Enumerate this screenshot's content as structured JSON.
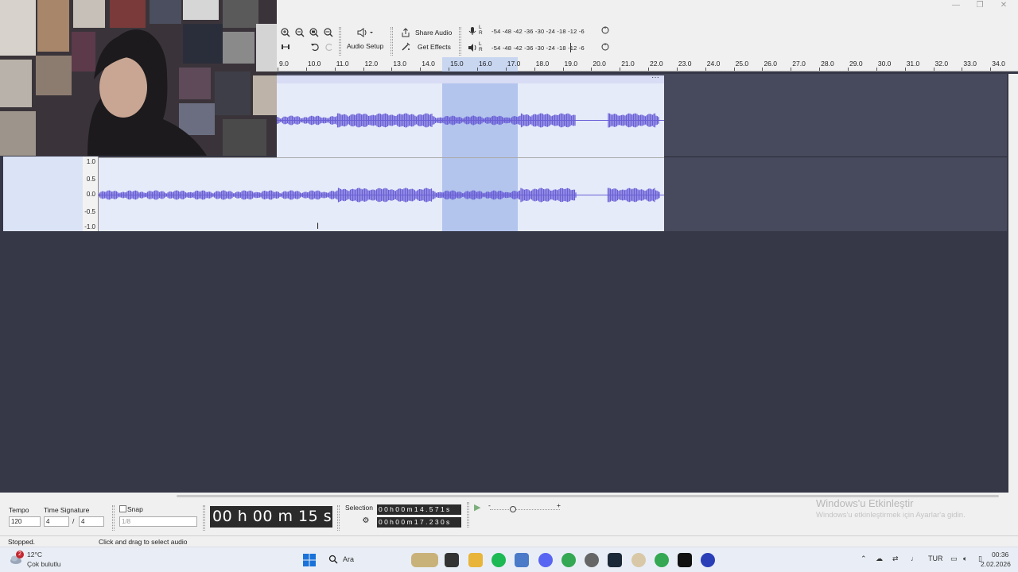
{
  "window": {
    "minimize": "—",
    "maximize": "❐",
    "close": "✕"
  },
  "toolbar": {
    "audio_setup_label": "Audio Setup",
    "share_audio_label": "Share Audio",
    "get_effects_label": "Get Effects",
    "record_meter_scale": "-54  -48  -42  -36  -30  -24  -18  -12  -6",
    "play_meter_scale": "-54  -48  -42  -36  -30  -24  -18  -12  -6",
    "lr": "L\nR"
  },
  "ruler": {
    "ticks": [
      "9.0",
      "10.0",
      "11.0",
      "12.0",
      "13.0",
      "14.0",
      "15.0",
      "16.0",
      "17.0",
      "18.0",
      "19.0",
      "20.0",
      "21.0",
      "22.0",
      "23.0",
      "24.0",
      "25.0",
      "26.0",
      "27.0",
      "28.0",
      "29.0",
      "30.0",
      "31.0",
      "32.0",
      "33.0",
      "34.0"
    ]
  },
  "track": {
    "menu": "···",
    "scale": [
      "1.0",
      "0.5",
      "0.0",
      "-0.5",
      "-1.0"
    ]
  },
  "bottom": {
    "tempo_label": "Tempo",
    "tempo_value": "120",
    "time_signature_label": "Time Signature",
    "ts_num": "4",
    "ts_sep": "/",
    "ts_den": "4",
    "snap_label": "Snap",
    "snap_value": "1/8",
    "time_display": "00 h 00 m 15 s",
    "selection_label": "Selection",
    "selection_start": "0 0 h 0 0 m 1 4 . 5 7 1 s",
    "selection_end": "0 0 h 0 0 m 1 7 . 2 3 0 s",
    "speed_min": "-",
    "speed_max": "+"
  },
  "watermark": {
    "title": "Windows'u Etkinleştir",
    "subtitle": "Windows'u etkinleştirmek için Ayarlar'a gidin."
  },
  "status": {
    "state": "Stopped.",
    "hint": "Click and drag to select audio"
  },
  "taskbar": {
    "weather_temp": "12°C",
    "weather_desc": "Çok bulutlu",
    "weather_badge": "2",
    "search_placeholder": "Ara",
    "lang": "TUR",
    "time": "00:36",
    "date": "2.02.2026"
  },
  "colors": {
    "waveform": "#6a5fd6",
    "selection": "#b3c4ed",
    "workspace_bg": "#363847",
    "clip_bg": "#e6ebfa"
  }
}
